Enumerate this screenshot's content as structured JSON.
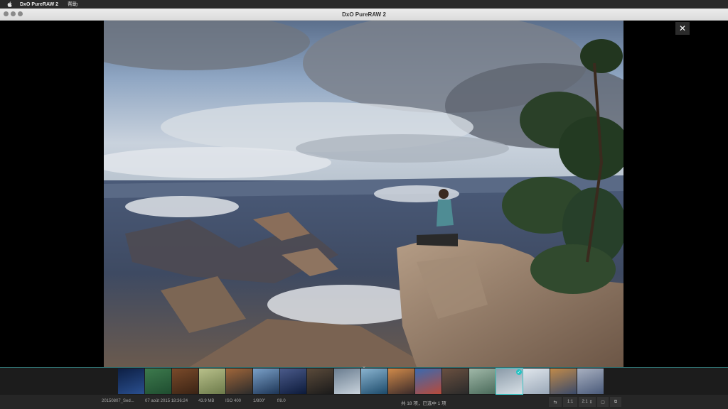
{
  "menubar": {
    "app_name": "DxO PureRAW 2",
    "menu_help": "帮助"
  },
  "window": {
    "title": "DxO PureRAW 2"
  },
  "viewer": {
    "close_label": "✕"
  },
  "filmstrip": {
    "expand_icon": "chevron-up-icon",
    "thumbs": [
      {
        "color": "#2a4f8f",
        "accent": "#0d1f44"
      },
      {
        "color": "#1f4d30",
        "accent": "#3d7a4d"
      },
      {
        "color": "#3a2314",
        "accent": "#7a4a2a"
      },
      {
        "color": "#6c7a4a",
        "accent": "#b8c08a"
      },
      {
        "color": "#2b2b2b",
        "accent": "#a0663a"
      },
      {
        "color": "#1d3556",
        "accent": "#7aa0c8"
      },
      {
        "color": "#0c1a3a",
        "accent": "#4a5a8a"
      },
      {
        "color": "#1a1a1a",
        "accent": "#5a4a3a"
      },
      {
        "color": "#c9d3dc",
        "accent": "#6a7d90"
      },
      {
        "color": "#1c4a6a",
        "accent": "#8ab4d0"
      },
      {
        "color": "#3a2a2a",
        "accent": "#d08a4a"
      },
      {
        "color": "#b84a3a",
        "accent": "#3a6ab0"
      },
      {
        "color": "#2a2a2a",
        "accent": "#6a5040"
      },
      {
        "color": "#4a6a5a",
        "accent": "#a0b8a8"
      },
      {
        "color": "#d8e0e6",
        "accent": "#8a9aa8",
        "selected": true
      },
      {
        "color": "#9aa8b8",
        "accent": "#e0e6ec"
      },
      {
        "color": "#3a4a6a",
        "accent": "#c08a4a"
      },
      {
        "color": "#4a5a7a",
        "accent": "#a8b0c0"
      }
    ]
  },
  "status": {
    "filename": "20150807_Sed...",
    "date": "07 août 2015 18:36:24",
    "filesize": "43.9 MB",
    "iso": "ISO 400",
    "shutter": "1/800\"",
    "aperture": "f/8.0",
    "selection_count": "共 18 项，已选中 1 项",
    "tool_1to1": "1:1",
    "tool_2to1": "2:1"
  }
}
